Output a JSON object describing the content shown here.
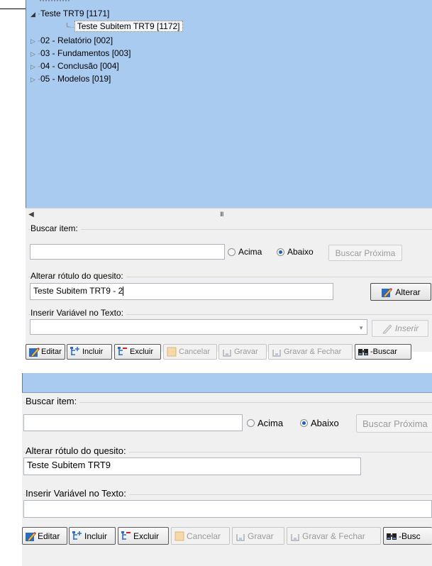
{
  "panel1": {
    "tree": {
      "items": [
        {
          "label": "Teste TRT9 [1171]",
          "expander": "open"
        },
        {
          "label": "Teste Subitem TRT9 [1172]",
          "selected": true
        },
        {
          "label": "02 - Relatório [002]",
          "expander": "closed"
        },
        {
          "label": "03 - Fundamentos [003]",
          "expander": "closed"
        },
        {
          "label": "04 - Conclusão [004]",
          "expander": "closed"
        },
        {
          "label": "05 - Modelos [019]",
          "expander": "closed"
        }
      ]
    },
    "search": {
      "label": "Buscar item:",
      "value": "",
      "radio_up": "Acima",
      "radio_down": "Abaixo",
      "selected_direction": "Abaixo",
      "next_button": "Buscar Próxima"
    },
    "rename": {
      "label": "Alterar rótulo do quesito:",
      "value": "Teste Subitem TRT9 - 2",
      "button": "Alterar"
    },
    "insert_var": {
      "label": "Inserir Variável no Texto:",
      "value": "",
      "button": "Inserir"
    },
    "toolbar": {
      "editar": "Editar",
      "incluir": "Incluir",
      "excluir": "Excluir",
      "cancelar": "Cancelar",
      "gravar": "Gravar",
      "gravar_fechar": "Gravar & Fechar",
      "buscar": "-Buscar"
    }
  },
  "panel2": {
    "search": {
      "label": "Buscar item:",
      "value": "",
      "radio_up": "Acima",
      "radio_down": "Abaixo",
      "selected_direction": "Abaixo",
      "next_button": "Buscar Próxima"
    },
    "rename": {
      "label": "Alterar rótulo do quesito:",
      "value": "Teste Subitem TRT9"
    },
    "insert_var": {
      "label": "Inserir Variável no Texto:",
      "value": ""
    },
    "toolbar": {
      "editar": "Editar",
      "incluir": "Incluir",
      "excluir": "Excluir",
      "cancelar": "Cancelar",
      "gravar": "Gravar",
      "gravar_fechar": "Gravar & Fechar",
      "buscar": "-Busc"
    }
  },
  "colors": {
    "tree_background": "#a9cbf0",
    "panel_background": "#f0f0f0",
    "radio_selected": "#1b5fb8"
  },
  "icons": {
    "edit": "pencil-icon",
    "add": "tree-add-icon",
    "delete": "tree-remove-icon",
    "cancel": "cancel-doc-icon",
    "save": "save-icon",
    "save_close": "save-close-icon",
    "search": "binoculars-icon",
    "expand_open": "triangle-down-icon",
    "expand_closed": "triangle-right-icon"
  }
}
